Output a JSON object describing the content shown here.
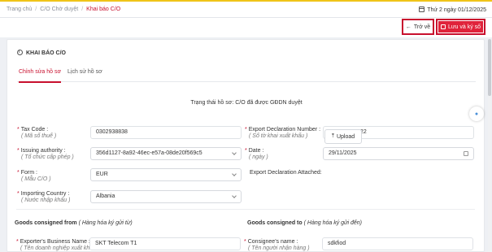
{
  "breadcrumb": {
    "home": "Trang chủ",
    "parent": "C/O Chờ duyệt",
    "current": "Khai báo C/O"
  },
  "header": {
    "date": "Thứ 2 ngày 01/12/2025"
  },
  "actions": {
    "back_label": "Trở về",
    "save_label": "Lưu và ký số"
  },
  "section": {
    "title": "KHAI BÁO C/O"
  },
  "tabs": [
    {
      "label": "Chỉnh sửa hồ sơ",
      "active": true
    },
    {
      "label": "Lịch sử hồ sơ",
      "active": false
    }
  ],
  "status_text": "Trạng thái hồ sơ: C/O đã được GĐDN duyệt",
  "form": {
    "tax_code": {
      "label": "Tax Code :",
      "sub": "( Mã số thuế )",
      "value": "0302938838"
    },
    "issuing_authority": {
      "label": "Issuing authority :",
      "sub": "( Tổ chức cấp phép )",
      "value": "356d1127-8a92-46ec-e57a-08de20f569c5"
    },
    "form": {
      "label": "Form :",
      "sub": "( Mẫu C/O )",
      "value": "EUR"
    },
    "importing_country": {
      "label": "Importing Country :",
      "sub": "( Nước nhập khẩu )",
      "value": "Albania"
    },
    "export_declaration_number": {
      "label": "Export Declaration Number :",
      "sub": "( Số tờ khai xuất khẩu )",
      "value": "222222222222"
    },
    "date": {
      "label": "Date :",
      "sub": "( ngày )",
      "value": "29/11/2025"
    },
    "export_declaration_attached": {
      "label": "Export Declaration Attached:",
      "upload_label": "Upload"
    }
  },
  "goods_from": {
    "title": "Goods consigned from",
    "sub": "( Hàng hóa ký gửi từ)"
  },
  "goods_to": {
    "title": "Goods consigned to",
    "sub": "( Hàng hóa ký gửi đến)"
  },
  "exporter": {
    "label": "Exporter's Business Name :",
    "sub": "( Tên doanh nghiệp xuất khẩu",
    "value": "SKT Telecom T1"
  },
  "consignee": {
    "label": "Consignee's name :",
    "sub": "( Tên người nhận hàng )",
    "value": "sdkfiod"
  }
}
